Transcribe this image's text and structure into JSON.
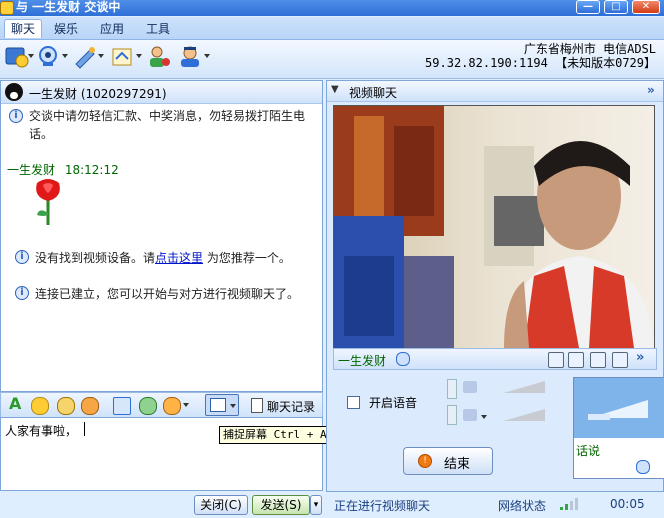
{
  "window": {
    "title": "与  一生发财  交谈中",
    "buttons": {
      "minimize": "—",
      "maximize": "□",
      "close": "✕"
    }
  },
  "menu": {
    "tabs": [
      {
        "label": "聊天",
        "active": true
      },
      {
        "label": "娱乐",
        "active": false
      },
      {
        "label": "应用",
        "active": false
      },
      {
        "label": "工具",
        "active": false
      }
    ]
  },
  "location": {
    "line1": "广东省梅州市  电信ADSL",
    "line2": "59.32.82.190:1194  【未知版本0729】"
  },
  "chat": {
    "peer_header": "一生发财 (1020297291)",
    "warning": "交谈中请勿轻信汇款、中奖消息，勿轻易拨打陌生电话。",
    "sender": "一生发财",
    "time": "18:12:12",
    "notice1_pre": "没有找到视频设备。请",
    "notice1_link": "点击这里",
    "notice1_post": " 为您推荐一个。",
    "notice2": "连接已建立，您可以开始与对方进行视频聊天了。",
    "history_label": "聊天记录",
    "input_text": "人家有事啦，",
    "close_button": "关闭(C)",
    "send_button": "发送(S)",
    "tooltip": "捕捉屏幕 Ctrl + Alt + A"
  },
  "video": {
    "header": "视频聊天",
    "peer_name": "一生发财",
    "voice_label": "开启语音",
    "voice_checked": false,
    "end_button": "结束",
    "self_label": "话说",
    "status_text": "正在进行视频聊天",
    "network_label": "网络状态",
    "timer": "00:05"
  },
  "colors": {
    "accent": "#2d6fd6",
    "link": "#0015c8",
    "sender_name": "#006600"
  }
}
